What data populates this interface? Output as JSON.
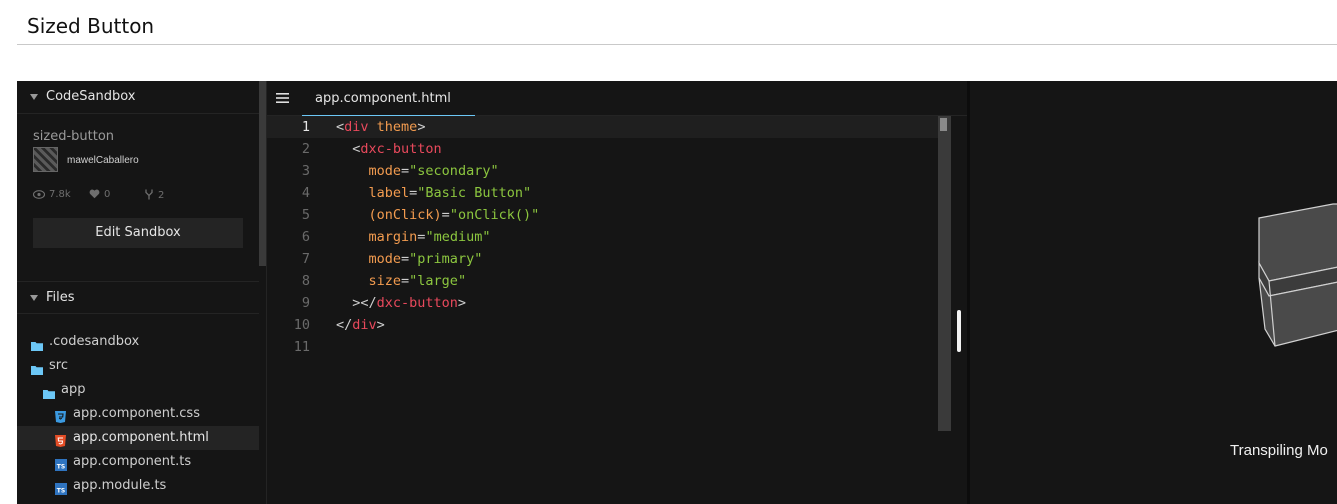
{
  "page": {
    "title": "Sized Button"
  },
  "sidebar": {
    "header": "CodeSandbox",
    "sandbox_name": "sized-button",
    "author": "mawelCaballero",
    "stats": {
      "views": "7.8k",
      "likes": "0",
      "forks": "2"
    },
    "edit_button": "Edit Sandbox",
    "files_header": "Files",
    "files": [
      {
        "name": ".codesandbox",
        "icon": "folder-icon",
        "depth": 0,
        "active": false
      },
      {
        "name": "src",
        "icon": "folder-icon",
        "depth": 0,
        "active": false
      },
      {
        "name": "app",
        "icon": "folder-icon",
        "depth": 1,
        "active": false
      },
      {
        "name": "app.component.css",
        "icon": "css-icon",
        "depth": 2,
        "active": false
      },
      {
        "name": "app.component.html",
        "icon": "html-icon",
        "depth": 2,
        "active": true
      },
      {
        "name": "app.component.ts",
        "icon": "ts-icon",
        "depth": 2,
        "active": false
      },
      {
        "name": "app.module.ts",
        "icon": "ts-icon",
        "depth": 2,
        "active": false
      }
    ]
  },
  "editor": {
    "tab_label": "app.component.html",
    "current_line": 1,
    "lines": [
      [
        [
          "punc",
          "<"
        ],
        [
          "tag",
          "div"
        ],
        [
          "punc",
          " "
        ],
        [
          "attr",
          "theme"
        ],
        [
          "punc",
          ">"
        ]
      ],
      [
        [
          "punc",
          "  <"
        ],
        [
          "tag",
          "dxc-button"
        ]
      ],
      [
        [
          "punc",
          "    "
        ],
        [
          "attr",
          "mode"
        ],
        [
          "punc",
          "="
        ],
        [
          "str",
          "\"secondary\""
        ]
      ],
      [
        [
          "punc",
          "    "
        ],
        [
          "attr",
          "label"
        ],
        [
          "punc",
          "="
        ],
        [
          "str",
          "\"Basic Button\""
        ]
      ],
      [
        [
          "punc",
          "    "
        ],
        [
          "attr",
          "(onClick)"
        ],
        [
          "punc",
          "="
        ],
        [
          "str",
          "\"onClick()\""
        ]
      ],
      [
        [
          "punc",
          "    "
        ],
        [
          "attr",
          "margin"
        ],
        [
          "punc",
          "="
        ],
        [
          "str",
          "\"medium\""
        ]
      ],
      [
        [
          "punc",
          "    "
        ],
        [
          "attr",
          "mode"
        ],
        [
          "punc",
          "="
        ],
        [
          "str",
          "\"primary\""
        ]
      ],
      [
        [
          "punc",
          "    "
        ],
        [
          "attr",
          "size"
        ],
        [
          "punc",
          "="
        ],
        [
          "str",
          "\"large\""
        ]
      ],
      [
        [
          "punc",
          "  ></"
        ],
        [
          "tag",
          "dxc-button"
        ],
        [
          "punc",
          ">"
        ]
      ],
      [
        [
          "punc",
          "</"
        ],
        [
          "tag",
          "div"
        ],
        [
          "punc",
          ">"
        ]
      ],
      []
    ]
  },
  "preview": {
    "status": "Transpiling Mo"
  },
  "colors": {
    "background": "#151515",
    "accent_tab": "#6cc7f6",
    "tag": "#e8495c",
    "attribute": "#f29b4f",
    "string": "#8cc63f",
    "folder": "#6cc7f6",
    "html_icon": "#e44d26",
    "css_icon": "#3b9ae1",
    "ts_icon": "#2f74c0"
  }
}
